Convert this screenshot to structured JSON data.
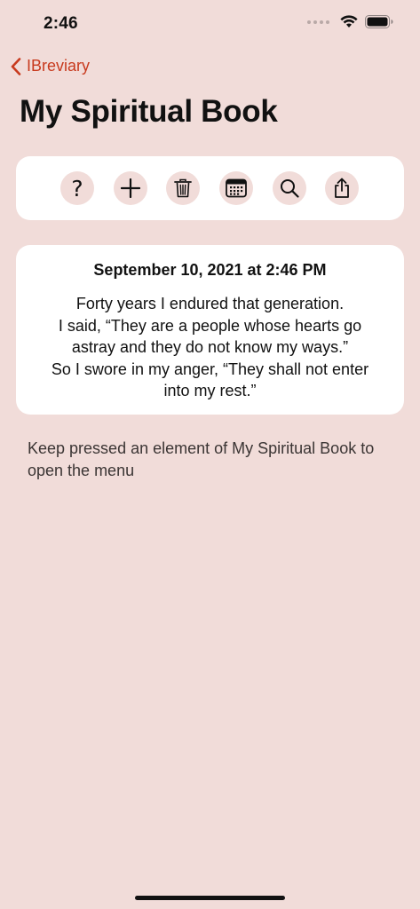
{
  "status_bar": {
    "time": "2:46"
  },
  "nav": {
    "back_label": "IBreviary",
    "title": "My Spiritual Book"
  },
  "toolbar": {
    "buttons": [
      {
        "icon": "help-icon",
        "glyph": "?"
      },
      {
        "icon": "plus-icon"
      },
      {
        "icon": "trash-icon"
      },
      {
        "icon": "calendar-icon"
      },
      {
        "icon": "search-icon"
      },
      {
        "icon": "share-icon"
      }
    ]
  },
  "entry": {
    "date": "September 10, 2021 at 2:46 PM",
    "lines": [
      "Forty years I endured that generation.",
      "I said, “They are a people whose hearts go",
      "astray and they do not know my ways.”",
      "So I swore in my anger, “They shall not enter",
      "into my rest.”"
    ]
  },
  "hint": "Keep pressed an element of My Spiritual Book to open the menu",
  "colors": {
    "background": "#f1dcd9",
    "accent": "#c83a1e",
    "card": "#ffffff"
  }
}
